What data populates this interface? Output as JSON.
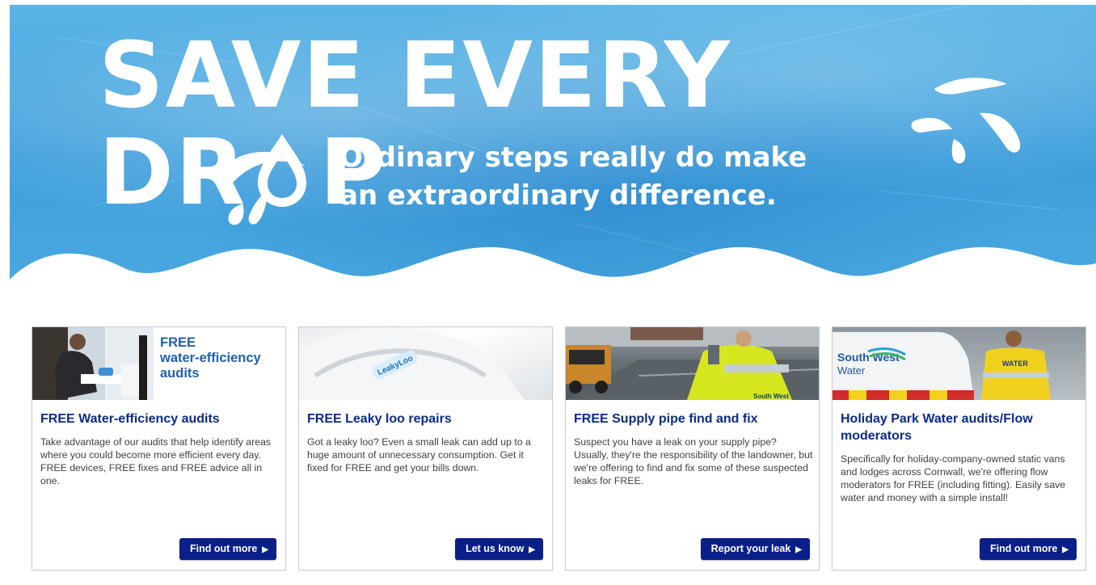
{
  "hero": {
    "title_part1": "SAVE EVERY DR",
    "title_part2": "P",
    "subtitle_line1": "Ordinary steps really do make",
    "subtitle_line2": "an extraordinary difference."
  },
  "cards": [
    {
      "image_overlay": [
        "FREE",
        "water-efficiency",
        "audits"
      ],
      "title": "FREE Water-efficiency audits",
      "text": "Take advantage of our audits that help identify areas where you could become more efficient every day. FREE devices, FREE fixes and FREE advice all in one.",
      "button": "Find out more"
    },
    {
      "image_label": "LeakyLoo",
      "title": "FREE Leaky loo repairs",
      "text": "Got a leaky loo? Even a small leak can add up to a huge amount of unnecessary consumption. Get it fixed for FREE and get your bills down.",
      "button": "Let us know"
    },
    {
      "image_label": "South West",
      "title": "FREE Supply pipe find and fix",
      "text": "Suspect you have a leak on your supply pipe? Usually, they're the responsibility of the landowner, but we're offering to find and fix some of these suspected leaks for FREE.",
      "button": "Report your leak"
    },
    {
      "image_labels": [
        "South West",
        "Water",
        "WATER"
      ],
      "title": "Holiday Park Water audits/Flow moderators",
      "text": "Specifically for holiday-company-owned static vans and lodges across Cornwall, we're offering flow moderators for FREE (including fitting). Easily save water and money with a simple install!",
      "button": "Find out more"
    }
  ],
  "colors": {
    "hero_blue": "#4aa8e0",
    "card_title": "#0b2a8c",
    "button_bg": "#0b1f8a"
  }
}
